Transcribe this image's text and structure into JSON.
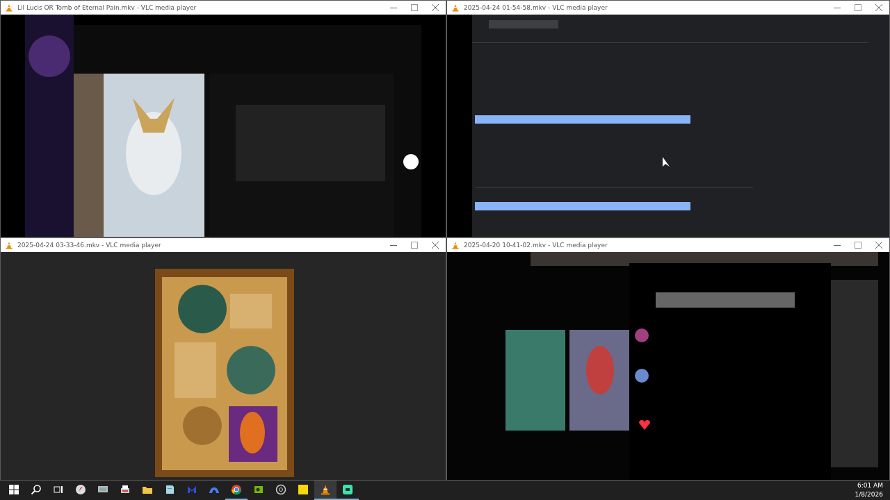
{
  "windows": [
    {
      "title": "Lil Lucis OR Tomb of Eternal Pain.mkv - VLC media player"
    },
    {
      "title": "2025-04-24 01-54-58.mkv - VLC media player"
    },
    {
      "title": "2025-04-24 03-33-46.mkv - VLC media player"
    },
    {
      "title": "2025-04-20 10-41-02.mkv - VLC media player"
    }
  ],
  "taskbar": {
    "apps": [
      {
        "kind": "compass",
        "running": false,
        "selected": false
      },
      {
        "kind": "monitor",
        "running": false,
        "selected": false
      },
      {
        "kind": "printer",
        "running": false,
        "selected": false
      },
      {
        "kind": "folder",
        "running": false,
        "selected": false
      },
      {
        "kind": "notepad",
        "running": false,
        "selected": false
      },
      {
        "kind": "mlogo",
        "running": false,
        "selected": false
      },
      {
        "kind": "arch",
        "running": false,
        "selected": false
      },
      {
        "kind": "browser",
        "running": true,
        "selected": false
      },
      {
        "kind": "chip",
        "running": false,
        "selected": false
      },
      {
        "kind": "aperture",
        "running": false,
        "selected": false
      },
      {
        "kind": "note",
        "running": false,
        "selected": false
      },
      {
        "kind": "cone",
        "running": true,
        "selected": true
      },
      {
        "kind": "greenapp",
        "running": true,
        "selected": false
      }
    ],
    "time": "6:01 AM",
    "date": "1/8/2026"
  }
}
